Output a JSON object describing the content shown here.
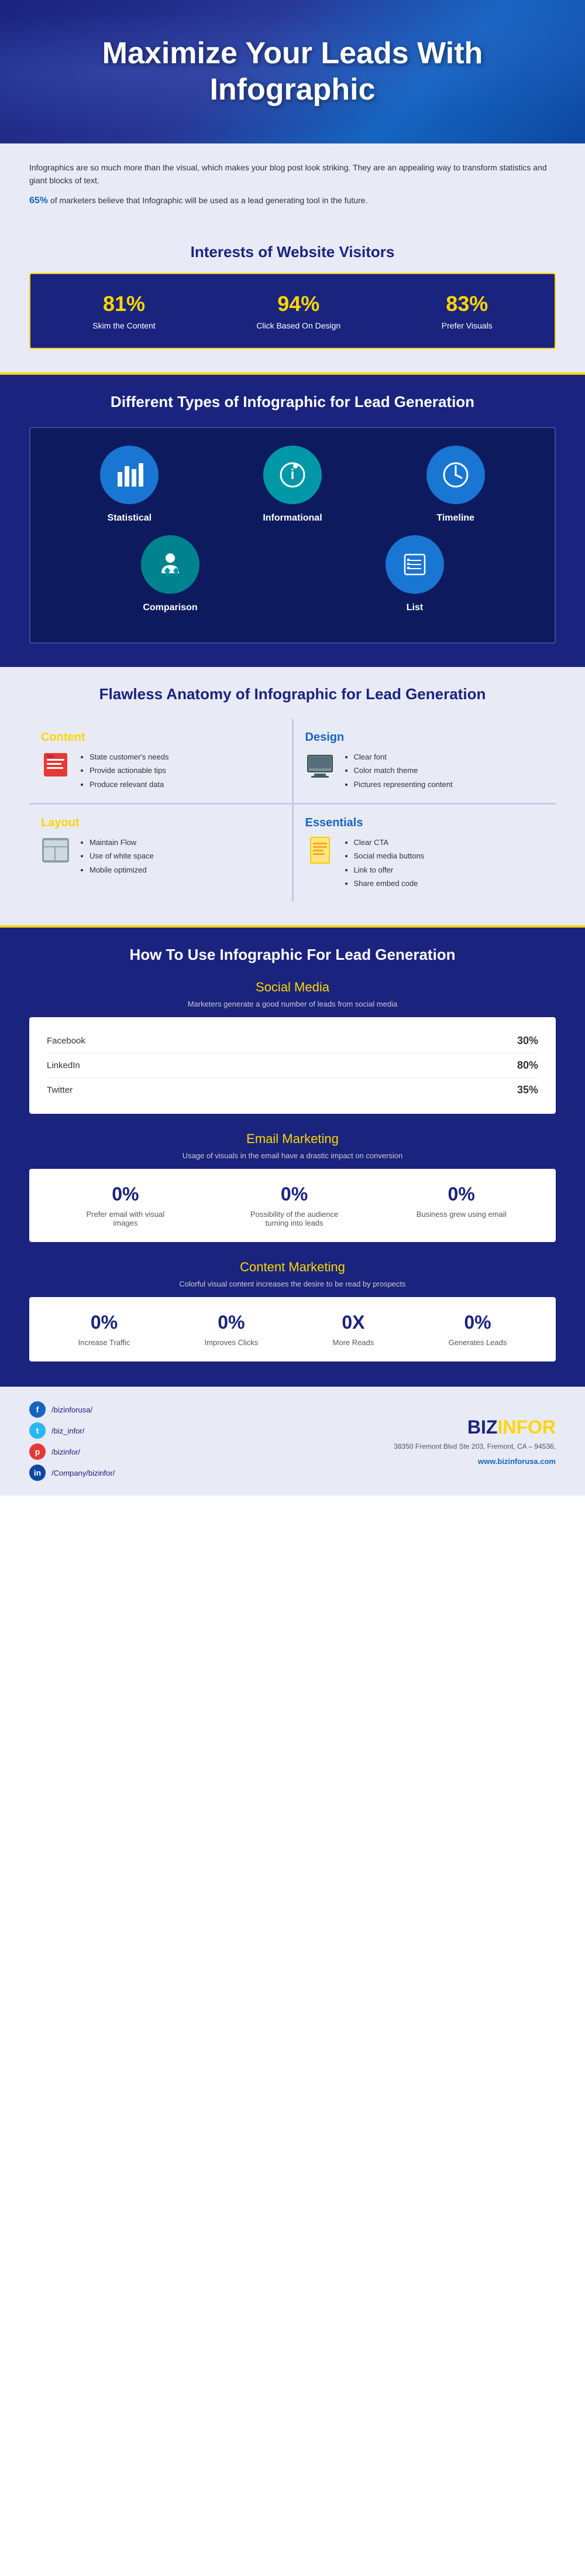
{
  "hero": {
    "title": "Maximize Your Leads With Infographic"
  },
  "intro": {
    "para1": "Infographics are so much more than the visual, which makes your blog post look striking. They are an appealing way to transform statistics and giant blocks of text.",
    "highlight_pct": "65%",
    "para2": "of marketers believe that Infographic will be used as a lead generating tool in the future."
  },
  "interests": {
    "title": "Interests of Website Visitors",
    "items": [
      {
        "pct": "81%",
        "label": "Skim the Content"
      },
      {
        "pct": "94%",
        "label": "Click Based On Design"
      },
      {
        "pct": "83%",
        "label": "Prefer Visuals"
      }
    ]
  },
  "types": {
    "title": "Different Types of Infographic for Lead Generation",
    "items": [
      {
        "name": "Statistical",
        "icon": "📊"
      },
      {
        "name": "Informational",
        "icon": "🔍"
      },
      {
        "name": "Timeline",
        "icon": "🕐"
      },
      {
        "name": "Comparison",
        "icon": "👤"
      },
      {
        "name": "List",
        "icon": "📋"
      }
    ]
  },
  "anatomy": {
    "title": "Flawless Anatomy of Infographic for Lead Generation",
    "content": {
      "label": "Content",
      "icon": "📝",
      "points": [
        "State customer's needs",
        "Provide actionable tips",
        "Produce relevant data"
      ]
    },
    "design": {
      "label": "Design",
      "icon": "🖥️",
      "points": [
        "Clear font",
        "Color match theme",
        "Pictures representing content"
      ]
    },
    "layout": {
      "label": "Layout",
      "icon": "🗃️",
      "points": [
        "Maintain Flow",
        "Use of white space",
        "Mobile optimized"
      ]
    },
    "essentials": {
      "label": "Essentials",
      "icon": "📋",
      "points": [
        "Clear CTA",
        "Social media buttons",
        "Link to offer",
        "Share embed code"
      ]
    }
  },
  "howto": {
    "title": "How To Use Infographic For Lead Generation",
    "social_media": {
      "title": "Social Media",
      "desc": "Marketers generate a good number of leads from social media",
      "items": [
        {
          "platform": "Facebook",
          "pct": "30%"
        },
        {
          "platform": "LinkedIn",
          "pct": "80%"
        },
        {
          "platform": "Twitter",
          "pct": "35%"
        }
      ]
    },
    "email_marketing": {
      "title": "Email Marketing",
      "desc": "Usage of visuals in the email have a drastic impact on conversion",
      "items": [
        {
          "pct": "0%",
          "label": "Prefer email with visual images"
        },
        {
          "pct": "0%",
          "label": "Possibility of the audience turning into leads"
        },
        {
          "pct": "0%",
          "label": "Business grew using email"
        }
      ]
    },
    "content_marketing": {
      "title": "Content Marketing",
      "desc": "Colorful visual content increases the desire to be read by prospects",
      "items": [
        {
          "pct": "0%",
          "label": "Increase Traffic"
        },
        {
          "pct": "0%",
          "label": "Improves Clicks"
        },
        {
          "pct": "0X",
          "label": "More Reads"
        },
        {
          "pct": "0%",
          "label": "Generates Leads"
        }
      ]
    }
  },
  "footer": {
    "social_links": [
      {
        "platform": "Facebook",
        "handle": "/bizinforusa/",
        "icon_class": "fb-icon",
        "icon_char": "f"
      },
      {
        "platform": "Twitter",
        "handle": "/biz_infor/",
        "icon_class": "tw-icon",
        "icon_char": "t"
      },
      {
        "platform": "Pinterest",
        "handle": "/bizinfor/",
        "icon_class": "pi-icon",
        "icon_char": "p"
      },
      {
        "platform": "LinkedIn",
        "handle": "/Company/bizinfor/",
        "icon_class": "li-icon",
        "icon_char": "in"
      }
    ],
    "brand": "BIZINFOR",
    "brand_highlight": "BIZINFOR",
    "address": "38350 Fremont Blvd Ste 203,\nFremont, CA – 94536,",
    "website": "www.bizinforusa.com"
  }
}
